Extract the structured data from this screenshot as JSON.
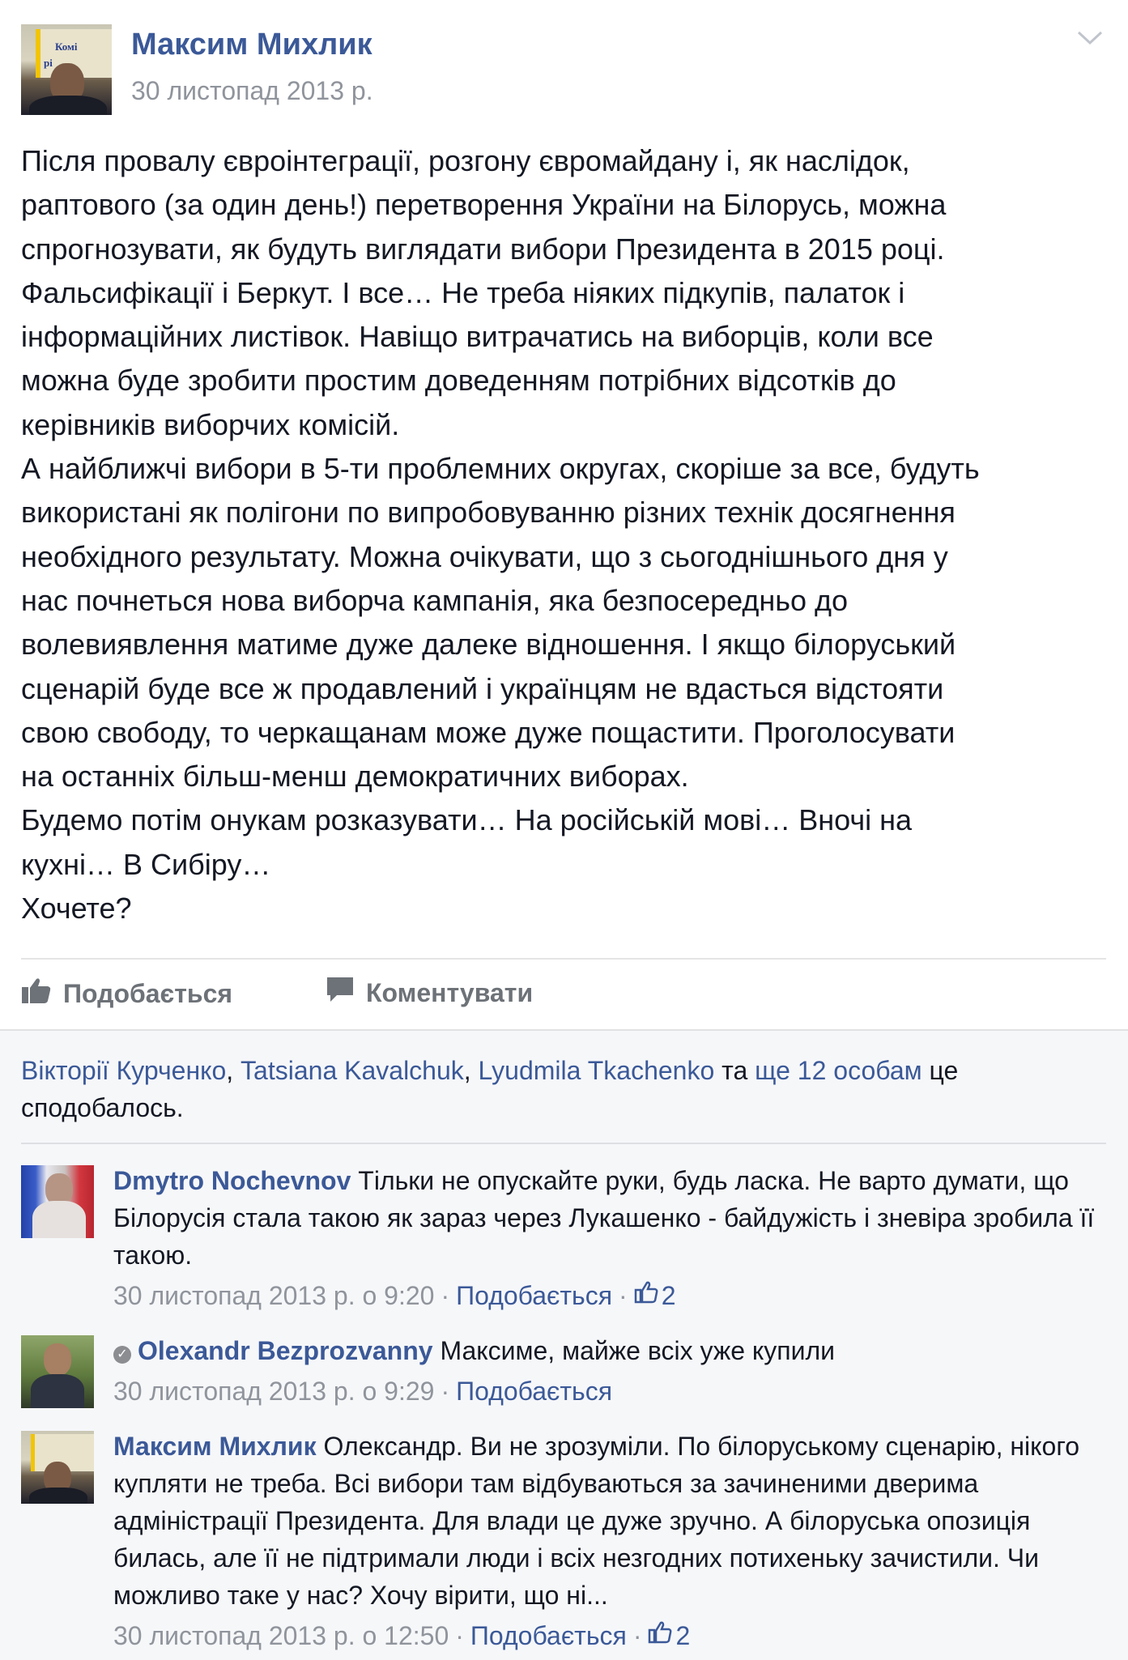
{
  "post": {
    "author": "Максим Михлик",
    "date": "30 листопад 2013 р.",
    "avatar_banner_l1": "Комі",
    "avatar_banner_l2": "рі",
    "paragraphs": [
      "Після провалу євроінтеграції, розгону євромайдану і, як наслідок,\nраптового (за один день!) перетворення України на Білорусь, можна\nспрогнозувати, як будуть виглядати вибори Президента в 2015 році.\nФальсифікації і Беркут. І все… Не треба ніяких підкупів, палаток і\nінформаційних листівок. Навіщо витрачатись на виборців, коли все\nможна буде зробити простим доведенням потрібних відсотків до\nкерівників виборчих комісій.",
      "А найближчі вибори в 5-ти проблемних округах, скоріше за все, будуть\nвикористані як полігони по випробовуванню різних технік досягнення\nнеобхідного результату. Можна очікувати, що з сьогоднішнього дня у\nнас почнеться нова виборча кампанія, яка безпосередньо до\nволевиявлення матиме дуже далеке відношення. І якщо білоруський\nсценарій буде все ж продавлений і українцям не вдасться відстояти\nсвою свободу, то черкащанам може дуже пощастити. Проголосувати\nна останніх більш-менш демократичних виборах.",
      "Будемо потім онукам розказувати… На російській мові… Вночі на\nкухні… В Сибіру…",
      "Хочете?"
    ]
  },
  "actions": {
    "like_label": "Подобається",
    "comment_label": "Коментувати"
  },
  "likes": {
    "name1": "Вікторії Курченко",
    "sep1": ", ",
    "name2": "Tatsiana Kavalchuk",
    "sep2": ", ",
    "name3": "Lyudmila Tkachenko",
    "and": " та ",
    "others": "ще 12 особам",
    "tail": " це сподобалось."
  },
  "comments": [
    {
      "name": "Dmytro Nochevnov",
      "text": " Тільки не опускайте руки, будь ласка. Не варто думати, що Білорусія стала такою як зараз через Лукашенко - байдужість і зневіра зробила її такою.",
      "time": "30 листопад 2013 р. о 9:20",
      "like_link": "Подобається",
      "like_count": "2"
    },
    {
      "name": "Olexandr Bezprozvanny",
      "text": " Максиме, майже всіх уже купили",
      "time": "30 листопад 2013 р. о 9:29",
      "like_link": "Подобається"
    },
    {
      "name": "Максим Михлик",
      "text": " Олександр. Ви не зрозуміли. По білоруському сценарію, нікого купляти не треба. Всі вибори там відбуваються за зачиненими дверима адміністрації Президента. Для влади це дуже зручно. А білоруська опозиція билась, але її не підтримали люди і всіх незгодних потихеньку зачистили. Чи можливо таке у нас? Хочу вірити, що ні...",
      "time": "30 листопад 2013 р. о 12:50",
      "like_link": "Подобається",
      "like_count": "2"
    }
  ]
}
